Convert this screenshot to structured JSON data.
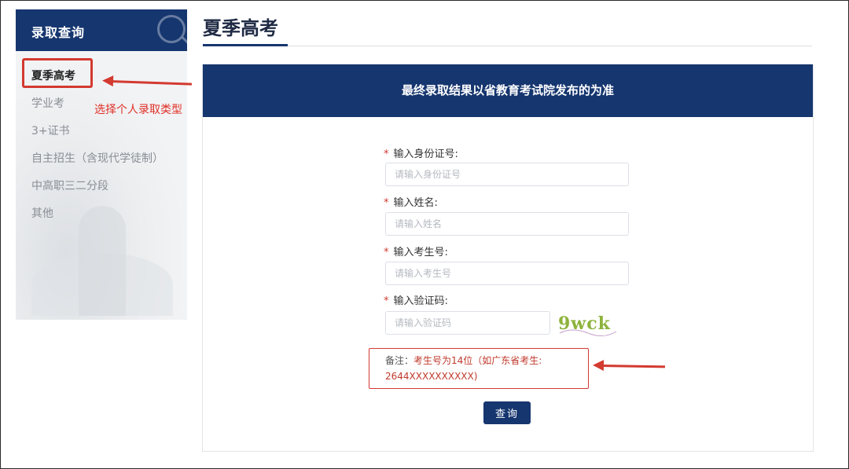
{
  "sidebar": {
    "title": "录取查询",
    "items": [
      {
        "label": "夏季高考",
        "active": true
      },
      {
        "label": "学业考"
      },
      {
        "label": "3+证书"
      },
      {
        "label": "自主招生（含现代学徒制）"
      },
      {
        "label": "中高职三二分段"
      },
      {
        "label": "其他"
      }
    ]
  },
  "annotation": {
    "select_type": "选择个人录取类型"
  },
  "main": {
    "page_title": "夏季高考",
    "banner": "最终录取结果以省教育考试院发布的为准",
    "form": {
      "required_mark": "*",
      "id_label": "输入身份证号:",
      "id_placeholder": "请输入身份证号",
      "name_label": "输入姓名:",
      "name_placeholder": "请输入姓名",
      "exam_label": "输入考生号:",
      "exam_placeholder": "请输入考生号",
      "captcha_label": "输入验证码:",
      "captcha_placeholder": "请输入验证码",
      "captcha_text": "9wck"
    },
    "note": {
      "label": "备注：",
      "text_line1": "考生号为14位（如广东省考生:",
      "text_line2": "2644XXXXXXXXXX)"
    },
    "query_button": "查询"
  },
  "colors": {
    "brand_navy": "#16366f",
    "annotation_red": "#d33a30"
  }
}
